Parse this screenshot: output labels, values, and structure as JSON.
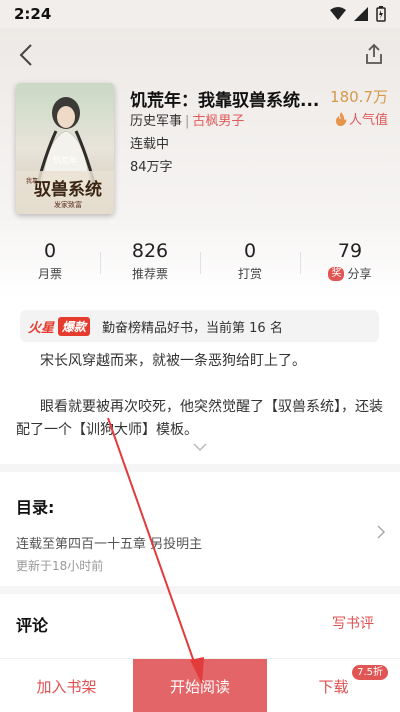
{
  "statusbar": {
    "time": "2:24"
  },
  "book": {
    "title": "饥荒年：我靠驭兽系统...",
    "category": "历史军事",
    "separator": "|",
    "tag": "古枫男子",
    "status": "连载中",
    "word_count": "84万字",
    "popularity_value": "180.7万",
    "popularity_label": "人气值",
    "cover": {
      "top_text": "饥荒年",
      "main_text": "驭兽系统",
      "small_left": "我靠",
      "sub_text": "发家致富"
    }
  },
  "stats": [
    {
      "value": "0",
      "label": "月票"
    },
    {
      "value": "826",
      "label": "推荐票"
    },
    {
      "value": "0",
      "label": "打赏"
    },
    {
      "value": "79",
      "label": "分享",
      "badge": "奖"
    }
  ],
  "bulletin": {
    "hot_label": "火星",
    "badge": "爆款",
    "text": "勤奋榜精品好书，当前第 16 名"
  },
  "intro": {
    "p1": "宋长风穿越而来，就被一条恶狗给盯上了。",
    "p2": "眼看就要被再次咬死，他突然觉醒了【驭兽系统】，还装配了一个【训狗大师】模板。"
  },
  "toc": {
    "title": "目录:",
    "latest": "连载至第四百一十五章 另投明主",
    "updated": "更新于18小时前"
  },
  "comments": {
    "title": "评论",
    "write": "写书评"
  },
  "bottombar": {
    "shelf": "加入书架",
    "read": "开始阅读",
    "download": "下载",
    "discount": "7.5折"
  },
  "colors": {
    "accent": "#e46567",
    "gold": "#d59a4a",
    "arrow": "#e23b3b"
  }
}
